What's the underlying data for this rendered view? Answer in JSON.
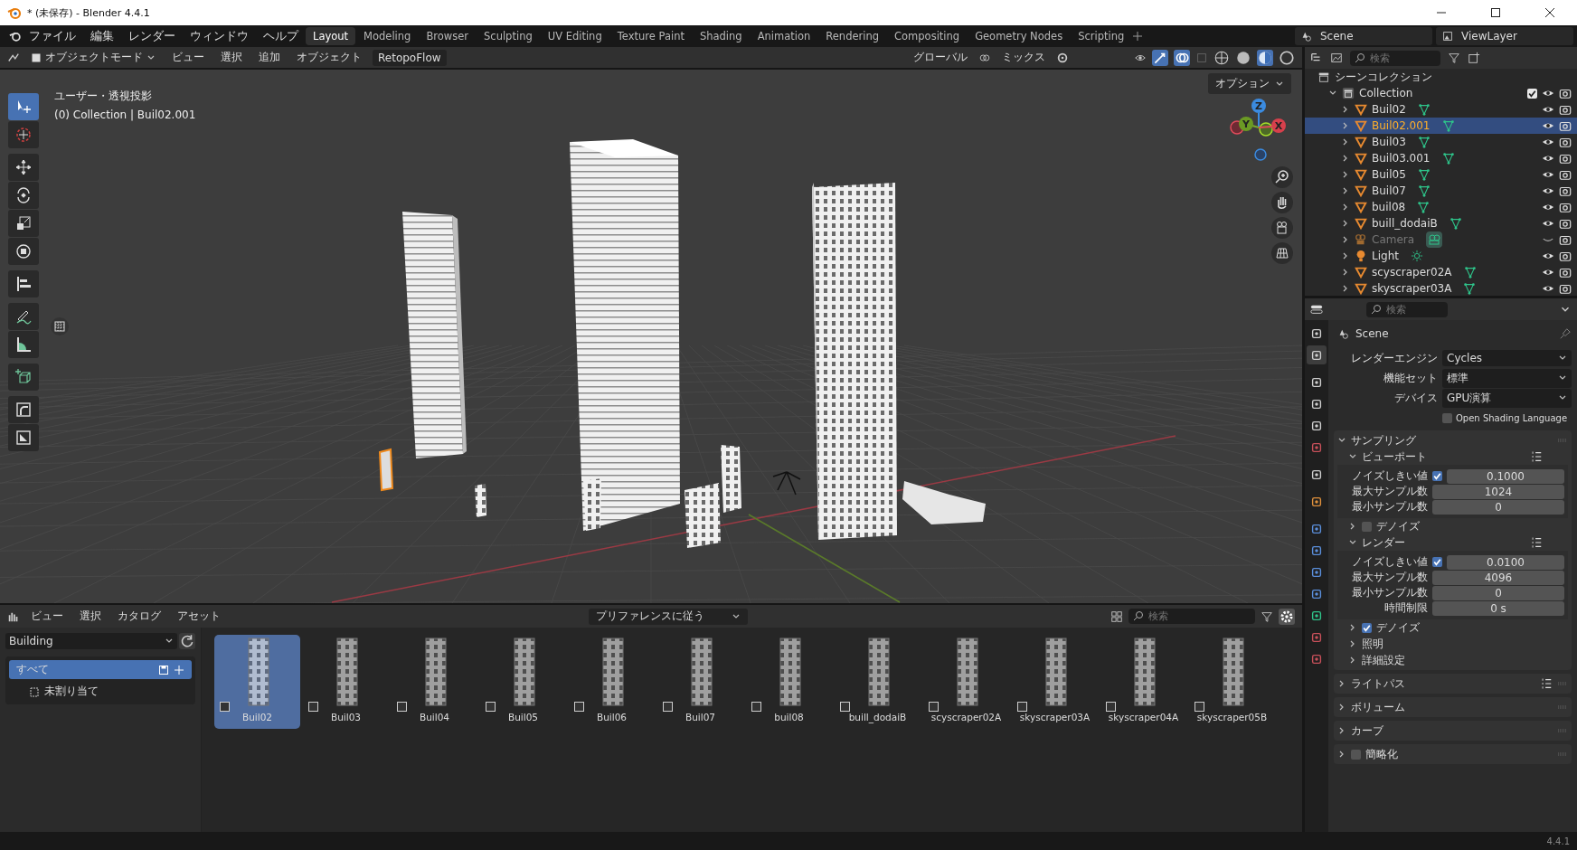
{
  "window": {
    "title": "* (未保存) - Blender 4.4.1"
  },
  "menu": [
    "ファイル",
    "編集",
    "レンダー",
    "ウィンドウ",
    "ヘルプ"
  ],
  "workspaces": [
    {
      "label": "Layout",
      "selected": true
    },
    {
      "label": "Modeling",
      "selected": false
    },
    {
      "label": "Browser",
      "selected": false
    },
    {
      "label": "Sculpting",
      "selected": false
    },
    {
      "label": "UV Editing",
      "selected": false
    },
    {
      "label": "Texture Paint",
      "selected": false
    },
    {
      "label": "Shading",
      "selected": false
    },
    {
      "label": "Animation",
      "selected": false
    },
    {
      "label": "Rendering",
      "selected": false
    },
    {
      "label": "Compositing",
      "selected": false
    },
    {
      "label": "Geometry Nodes",
      "selected": false
    },
    {
      "label": "Scripting",
      "selected": false
    }
  ],
  "scene": "Scene",
  "view_layer": "ViewLayer",
  "viewport": {
    "mode": "オブジェクトモード",
    "menus": [
      "ビュー",
      "選択",
      "追加",
      "オブジェクト"
    ],
    "addon": "RetopoFlow",
    "orientation": "グローバル",
    "snap": "ミックス",
    "options": "オプション",
    "view_name": "ユーザー・透視投影",
    "context": "(0) Collection | Buil02.001",
    "axes": [
      "Z",
      "Y",
      "X"
    ],
    "tool_groups": [
      [
        {
          "kind": "select",
          "selected": true
        },
        {
          "kind": "cursor",
          "selected": false
        }
      ],
      [
        {
          "kind": "move",
          "selected": false
        },
        {
          "kind": "rotate",
          "selected": false
        },
        {
          "kind": "scale",
          "selected": false
        },
        {
          "kind": "transform",
          "selected": false
        }
      ],
      [
        {
          "kind": "align",
          "selected": false
        }
      ],
      [
        {
          "kind": "annotate",
          "selected": false
        },
        {
          "kind": "measure",
          "selected": false
        }
      ],
      [
        {
          "kind": "add_cube",
          "selected": false
        }
      ],
      [
        {
          "kind": "corner",
          "selected": false
        },
        {
          "kind": "square",
          "selected": false
        }
      ]
    ]
  },
  "outliner": {
    "search_placeholder": "検索",
    "root": "シーンコレクション",
    "collection": {
      "name": "Collection",
      "expanded": true,
      "checked": true,
      "children": [
        {
          "name": "Buil02",
          "kind": "mesh",
          "selected": false,
          "visible": true
        },
        {
          "name": "Buil02.001",
          "kind": "mesh",
          "selected": true,
          "visible": true
        },
        {
          "name": "Buil03",
          "kind": "mesh",
          "selected": false,
          "visible": true
        },
        {
          "name": "Buil03.001",
          "kind": "mesh",
          "selected": false,
          "visible": true
        },
        {
          "name": "Buil05",
          "kind": "mesh",
          "selected": false,
          "visible": true
        },
        {
          "name": "Buil07",
          "kind": "mesh",
          "selected": false,
          "visible": true
        },
        {
          "name": "buil08",
          "kind": "mesh",
          "selected": false,
          "visible": true
        },
        {
          "name": "buill_dodaiB",
          "kind": "mesh",
          "selected": false,
          "visible": true
        },
        {
          "name": "Camera",
          "kind": "camera",
          "selected": false,
          "visible": false
        },
        {
          "name": "Light",
          "kind": "light",
          "selected": false,
          "visible": true
        },
        {
          "name": "scyscraper02A",
          "kind": "mesh",
          "selected": false,
          "visible": true
        },
        {
          "name": "skyscraper03A",
          "kind": "mesh",
          "selected": false,
          "visible": true
        }
      ]
    }
  },
  "properties": {
    "search_placeholder": "検索",
    "context": "Scene",
    "tabs": [
      {
        "kind": "tool",
        "selected": false
      },
      {
        "kind": "render",
        "selected": true
      },
      {
        "kind": "output",
        "selected": false
      },
      {
        "kind": "view_layer",
        "selected": false
      },
      {
        "kind": "scene",
        "selected": false
      },
      {
        "kind": "world",
        "selected": false
      },
      {
        "kind": "collection",
        "selected": false
      },
      {
        "kind": "object",
        "selected": false
      },
      {
        "kind": "modifier",
        "selected": false
      },
      {
        "kind": "particles",
        "selected": false
      },
      {
        "kind": "physics",
        "selected": false
      },
      {
        "kind": "constraint",
        "selected": false
      },
      {
        "kind": "data",
        "selected": false
      },
      {
        "kind": "material",
        "selected": false
      },
      {
        "kind": "texture",
        "selected": false
      }
    ],
    "settings": [
      {
        "label": "レンダーエンジン",
        "value": "Cycles"
      },
      {
        "label": "機能セット",
        "value": "標準"
      },
      {
        "label": "デバイス",
        "value": "GPU演算"
      }
    ],
    "osl": {
      "label": "Open Shading Language",
      "checked": false
    },
    "panels": [
      {
        "title": "サンプリング",
        "expanded": true,
        "subpanels": [
          {
            "title": "ビューポート",
            "expanded": true,
            "presets": true,
            "fields": [
              {
                "label": "ノイズしきい値",
                "value": "0.1000",
                "checked": true
              },
              {
                "label": "最大サンプル数",
                "value": "1024"
              },
              {
                "label": "最小サンプル数",
                "value": "0"
              }
            ]
          },
          {
            "title": "デノイズ",
            "expanded": false,
            "checked": false
          },
          {
            "title": "レンダー",
            "expanded": true,
            "presets": true,
            "fields": [
              {
                "label": "ノイズしきい値",
                "value": "0.0100",
                "checked": true
              },
              {
                "label": "最大サンプル数",
                "value": "4096"
              },
              {
                "label": "最小サンプル数",
                "value": "0"
              },
              {
                "label": "時間制限",
                "value": "0 s"
              }
            ]
          },
          {
            "title": "デノイズ",
            "expanded": false,
            "checked": true
          },
          {
            "title": "照明",
            "expanded": false
          },
          {
            "title": "詳細設定",
            "expanded": false
          }
        ]
      },
      {
        "title": "ライトパス",
        "expanded": false,
        "presets": true
      },
      {
        "title": "ボリューム",
        "expanded": false
      },
      {
        "title": "カーブ",
        "expanded": false
      },
      {
        "title": "簡略化",
        "expanded": false,
        "checked": false
      }
    ]
  },
  "asset_browser": {
    "menus": [
      "ビュー",
      "選択",
      "カタログ",
      "アセット"
    ],
    "import_method": "プリファレンスに従う",
    "search_placeholder": "検索",
    "library": "Building",
    "catalogs": [
      {
        "label": "すべて",
        "selected": true
      },
      {
        "label": "未割り当て",
        "selected": false
      }
    ],
    "assets": [
      {
        "name": "Buil02",
        "selected": true,
        "checked": false
      },
      {
        "name": "Buil03",
        "selected": false,
        "checked": false
      },
      {
        "name": "Buil04",
        "selected": false,
        "checked": false
      },
      {
        "name": "Buil05",
        "selected": false,
        "checked": false
      },
      {
        "name": "Buil06",
        "selected": false,
        "checked": false
      },
      {
        "name": "Buil07",
        "selected": false,
        "checked": false
      },
      {
        "name": "buil08",
        "selected": false,
        "checked": false
      },
      {
        "name": "buill_dodaiB",
        "selected": false,
        "checked": false
      },
      {
        "name": "scyscraper02A",
        "selected": false,
        "checked": false
      },
      {
        "name": "skyscraper03A",
        "selected": false,
        "checked": false
      },
      {
        "name": "skyscraper04A",
        "selected": false,
        "checked": false
      },
      {
        "name": "skyscraper05B",
        "selected": false,
        "checked": false
      }
    ]
  },
  "status_bar": {
    "version": "4.4.1"
  }
}
